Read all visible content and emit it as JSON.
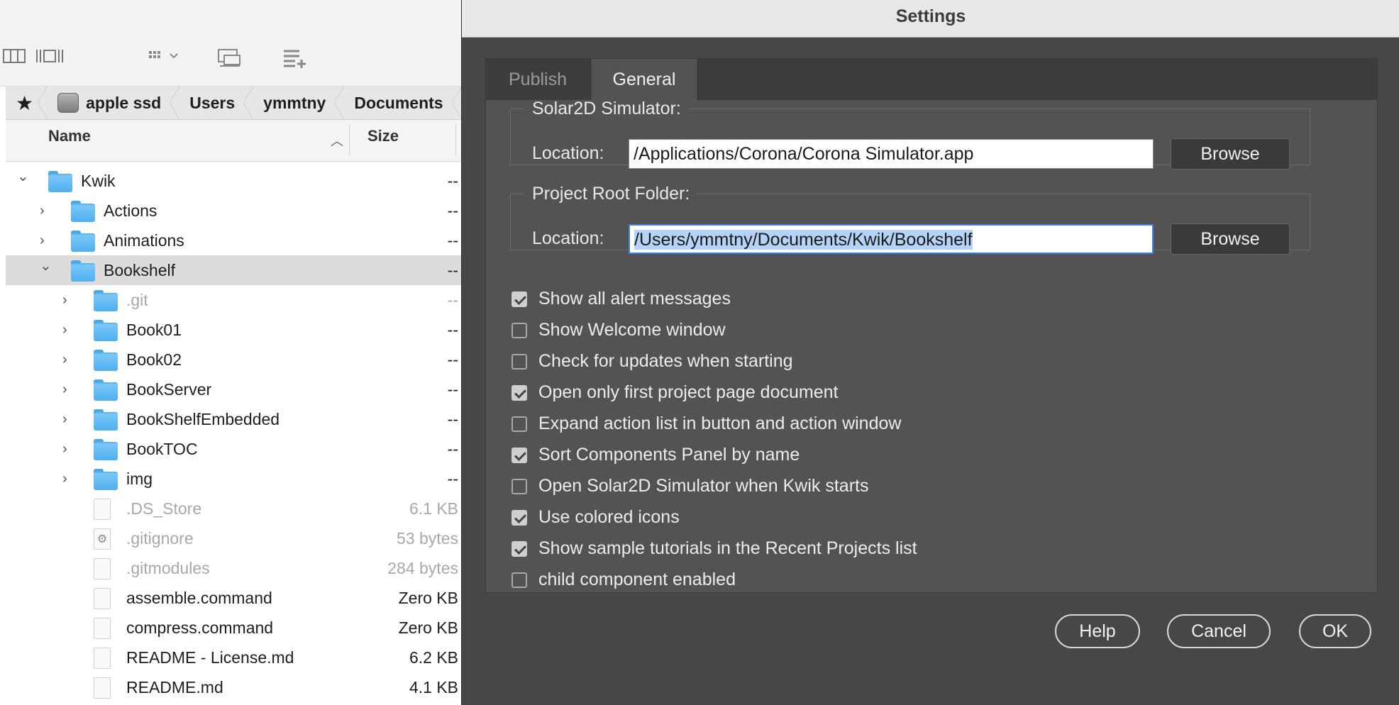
{
  "finder": {
    "breadcrumb": [
      "apple ssd",
      "Users",
      "ymmtny",
      "Documents"
    ],
    "columns": {
      "name": "Name",
      "size": "Size"
    },
    "rows": [
      {
        "name": "Kwik",
        "size": "--",
        "level": 0,
        "type": "folder",
        "expanded": true
      },
      {
        "name": "Actions",
        "size": "--",
        "level": 1,
        "type": "folder",
        "expanded": false
      },
      {
        "name": "Animations",
        "size": "--",
        "level": 1,
        "type": "folder",
        "expanded": false
      },
      {
        "name": "Bookshelf",
        "size": "--",
        "level": 1,
        "type": "folder",
        "expanded": true,
        "selected": true
      },
      {
        "name": ".git",
        "size": "--",
        "level": 2,
        "type": "folder",
        "expanded": false,
        "dim": true
      },
      {
        "name": "Book01",
        "size": "--",
        "level": 2,
        "type": "folder",
        "expanded": false
      },
      {
        "name": "Book02",
        "size": "--",
        "level": 2,
        "type": "folder",
        "expanded": false
      },
      {
        "name": "BookServer",
        "size": "--",
        "level": 2,
        "type": "folder",
        "expanded": false
      },
      {
        "name": "BookShelfEmbedded",
        "size": "--",
        "level": 2,
        "type": "folder",
        "expanded": false
      },
      {
        "name": "BookTOC",
        "size": "--",
        "level": 2,
        "type": "folder",
        "expanded": false
      },
      {
        "name": "img",
        "size": "--",
        "level": 2,
        "type": "folder",
        "expanded": false
      },
      {
        "name": ".DS_Store",
        "size": "6.1 KB",
        "level": 2,
        "type": "file",
        "dim": true
      },
      {
        "name": ".gitignore",
        "size": "53 bytes",
        "level": 2,
        "type": "gear",
        "dim": true
      },
      {
        "name": ".gitmodules",
        "size": "284 bytes",
        "level": 2,
        "type": "file",
        "dim": true
      },
      {
        "name": "assemble.command",
        "size": "Zero KB",
        "level": 2,
        "type": "file"
      },
      {
        "name": "compress.command",
        "size": "Zero KB",
        "level": 2,
        "type": "file"
      },
      {
        "name": "README - License.md",
        "size": "6.2 KB",
        "level": 2,
        "type": "file"
      },
      {
        "name": "README.md",
        "size": "4.1 KB",
        "level": 2,
        "type": "file"
      }
    ]
  },
  "dialog": {
    "title": "Settings",
    "tabs": [
      "Publish",
      "General"
    ],
    "active_tab": "General",
    "simulator_group": {
      "legend": "Solar2D Simulator:",
      "label": "Location:",
      "value": "/Applications/Corona/Corona Simulator.app",
      "browse": "Browse"
    },
    "project_group": {
      "legend": "Project Root Folder:",
      "label": "Location:",
      "value": "/Users/ymmtny/Documents/Kwik/Bookshelf",
      "browse": "Browse"
    },
    "options": [
      {
        "label": "Show all alert messages",
        "checked": true
      },
      {
        "label": "Show Welcome window",
        "checked": false
      },
      {
        "label": "Check for updates when starting",
        "checked": false
      },
      {
        "label": "Open only first project page document",
        "checked": true
      },
      {
        "label": "Expand action list in button and action window",
        "checked": false
      },
      {
        "label": "Sort Components Panel by name",
        "checked": true
      },
      {
        "label": "Open Solar2D Simulator when Kwik starts",
        "checked": false
      },
      {
        "label": "Use colored icons",
        "checked": true
      },
      {
        "label": "Show sample tutorials in the Recent Projects list",
        "checked": true
      },
      {
        "label": "child component enabled",
        "checked": false
      }
    ],
    "buttons": {
      "help": "Help",
      "cancel": "Cancel",
      "ok": "OK"
    }
  }
}
